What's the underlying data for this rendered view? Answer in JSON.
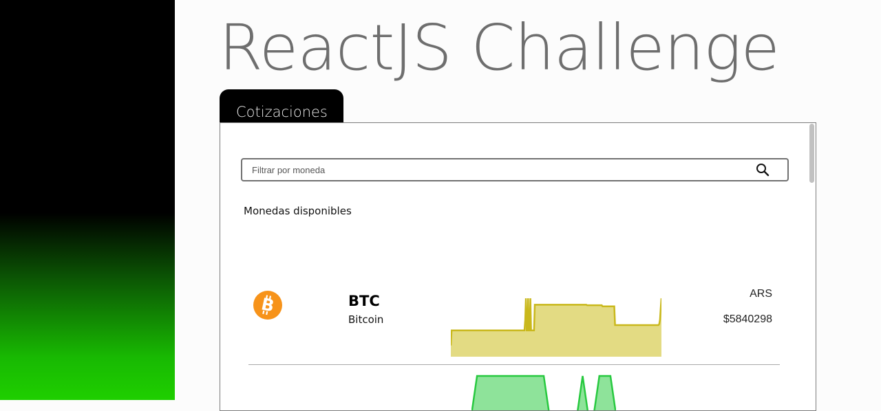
{
  "app": {
    "title": "ReactJS Challenge"
  },
  "tabs": [
    {
      "label": "Cotizaciones"
    }
  ],
  "search": {
    "placeholder": "Filtrar por moneda",
    "value": ""
  },
  "section": {
    "label": "Monedas disponibles"
  },
  "coins": [
    {
      "symbol": "BTC",
      "name": "Bitcoin",
      "icon": "bitcoin-icon",
      "currency": "ARS",
      "price": "$5840298",
      "spark_color": "#c9b81c",
      "spark_fill": "#e3db83",
      "sparkline": [
        0.12,
        0.4,
        0.4,
        0.4,
        0.4,
        0.4,
        0.4,
        0.4,
        0.4,
        0.4,
        0.4,
        0.4,
        0.4,
        0.4,
        0.4,
        0.4,
        0.4,
        0.4,
        0.4,
        0.4,
        0.4,
        0.4,
        0.4,
        0.4,
        0.4,
        0.4,
        0.4,
        0.4,
        0.4,
        0.4,
        0.4,
        0.4,
        0.4,
        0.4,
        0.4,
        0.4,
        0.4,
        0.4,
        0.4,
        0.4,
        0.4,
        0.4,
        0.4,
        0.4,
        0.4,
        0.4,
        0.4,
        0.4,
        0.4,
        0.4,
        0.4,
        0.4,
        0.4,
        0.4,
        0.4,
        0.4,
        0.4,
        0.4,
        0.4,
        0.4,
        0.4,
        0.4,
        0.4,
        0.4,
        0.4,
        0.4,
        0.4,
        0.4,
        0.4,
        0.4,
        0.4,
        0.4,
        0.4,
        0.4,
        0.4,
        0.4,
        0.4,
        0.4,
        0.4,
        0.4,
        0.4,
        0.4,
        0.4,
        0.4,
        0.4,
        0.4,
        0.4,
        0.4,
        0.4,
        0.4,
        0.4,
        0.4,
        0.4,
        0.4,
        0.4,
        0.4,
        0.4,
        0.4,
        0.4,
        0.4,
        0.4,
        0.6,
        1.0,
        0.4,
        0.4,
        1.0,
        0.4,
        0.4,
        1.0,
        0.4,
        0.4,
        0.4,
        0.4,
        0.4,
        0.88,
        0.88,
        0.88,
        0.88,
        0.88,
        0.88,
        0.88,
        0.88,
        0.88,
        0.88,
        0.88,
        0.88,
        0.88,
        0.88,
        0.88,
        0.88,
        0.88,
        0.88,
        0.88,
        0.88,
        0.88,
        0.88,
        0.88,
        0.88,
        0.88,
        0.88,
        0.88,
        0.88,
        0.88,
        0.88,
        0.88,
        0.88,
        0.88,
        0.88,
        0.88,
        0.88,
        0.88,
        0.88,
        0.88,
        0.88,
        0.88,
        0.88,
        0.88,
        0.88,
        0.88,
        0.88,
        0.88,
        0.88,
        0.88,
        0.88,
        0.88,
        0.88,
        0.88,
        0.88,
        0.88,
        0.88,
        0.88,
        0.88,
        0.88,
        0.88,
        0.88,
        0.88,
        0.88,
        0.88,
        0.88,
        0.88,
        0.88,
        0.88,
        0.88,
        0.88,
        0.88,
        0.87,
        0.87,
        0.87,
        0.87,
        0.87,
        0.87,
        0.87,
        0.87,
        0.87,
        0.87,
        0.87,
        0.87,
        0.87,
        0.87,
        0.87,
        0.87,
        0.87,
        0.87,
        0.87,
        0.87,
        0.87,
        0.85,
        0.85,
        0.85,
        0.85,
        0.85,
        0.85,
        0.85,
        0.85,
        0.85,
        0.85,
        0.85,
        0.85,
        0.85,
        0.85,
        0.85,
        0.85,
        0.85,
        0.5,
        0.5,
        0.5,
        0.5,
        0.5,
        0.5,
        0.5,
        0.5,
        0.5,
        0.5,
        0.5,
        0.5,
        0.5,
        0.5,
        0.5,
        0.5,
        0.5,
        0.5,
        0.5,
        0.5,
        0.5,
        0.5,
        0.5,
        0.5,
        0.5,
        0.5,
        0.5,
        0.5,
        0.5,
        0.5,
        0.5,
        0.5,
        0.5,
        0.5,
        0.5,
        0.5,
        0.5,
        0.5,
        0.5,
        0.5,
        0.5,
        0.5,
        0.5,
        0.5,
        0.5,
        0.5,
        0.5,
        0.5,
        0.5,
        0.5,
        0.5,
        0.5,
        0.5,
        0.5,
        0.5,
        0.5,
        0.5,
        0.5,
        0.5,
        0.5,
        0.52,
        0.6,
        0.8,
        1.0
      ]
    },
    {
      "spark_color": "#27c93f",
      "spark_fill": "#8ee39a",
      "sparkline": [
        0.0,
        1.0,
        1.0,
        1.0,
        1.0,
        1.0,
        1.0,
        1.0,
        1.0,
        1.0,
        1.0,
        1.0,
        1.0,
        1.0,
        0.0,
        0.0,
        0.0,
        0.0,
        0.0,
        0.0,
        1.0,
        0.0,
        0.0,
        1.0,
        1.0,
        1.0,
        0.0
      ]
    }
  ]
}
